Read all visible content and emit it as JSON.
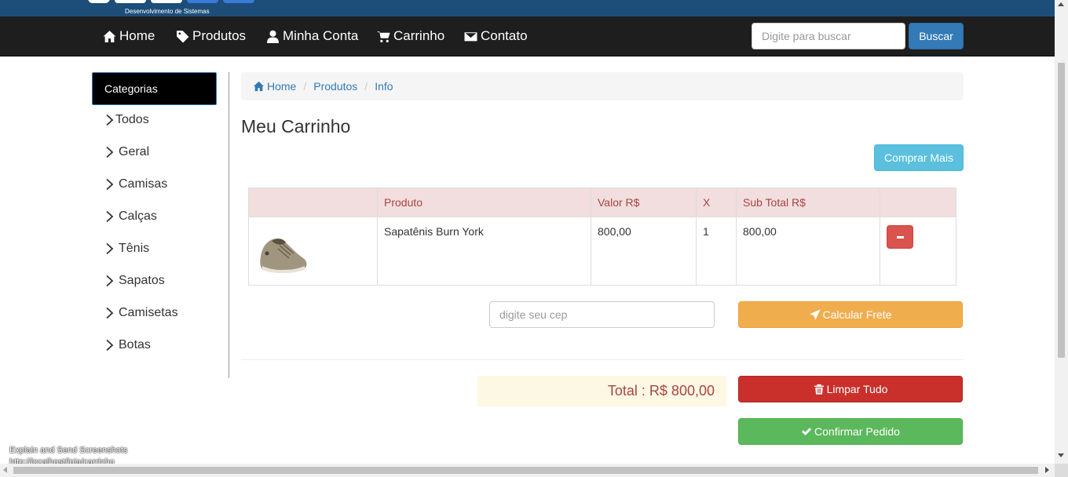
{
  "brand": {
    "subtitle": "Desenvolvimento de Sistemas"
  },
  "nav": {
    "items": [
      {
        "label": "Home",
        "icon": "home-icon"
      },
      {
        "label": "Produtos",
        "icon": "tag-icon"
      },
      {
        "label": "Minha Conta",
        "icon": "user-icon"
      },
      {
        "label": "Carrinho",
        "icon": "cart-icon"
      },
      {
        "label": "Contato",
        "icon": "envelope-icon"
      }
    ],
    "search_placeholder": "Digite para buscar",
    "search_button": "Buscar"
  },
  "sidebar": {
    "header": "Categorias",
    "items": [
      "Todos",
      "Geral",
      "Camisas",
      "Calças",
      "Tênis",
      "Sapatos",
      "Camisetas",
      "Botas"
    ]
  },
  "breadcrumb": [
    "Home",
    "Produtos",
    "Info"
  ],
  "page": {
    "title": "Meu Carrinho",
    "buy_more": "Comprar Mais"
  },
  "cart": {
    "columns": [
      "",
      "Produto",
      "Valor R$",
      "X",
      "Sub Total R$",
      ""
    ],
    "rows": [
      {
        "product": "Sapatênis Burn York",
        "price": "800,00",
        "qty": "1",
        "subtotal": "800,00"
      }
    ]
  },
  "shipping": {
    "cep_placeholder": "digite seu cep",
    "calc_button": "Calcular Frete"
  },
  "total": {
    "label": "Total :",
    "value": "R$ 800,00"
  },
  "actions": {
    "clear": "Limpar Tudo",
    "confirm": "Confirmar Pedido"
  },
  "overlay": {
    "line1": "Explain and Send Screenshots",
    "line2": "http://localhost/loja/carrinho"
  },
  "colors": {
    "navbar": "#1e1e1e",
    "brand_strip": "#1d4e7a",
    "primary": "#337ab7",
    "info": "#5bc0de",
    "warning": "#f0ad4e",
    "danger": "#c9302c",
    "success": "#5cb85c"
  }
}
